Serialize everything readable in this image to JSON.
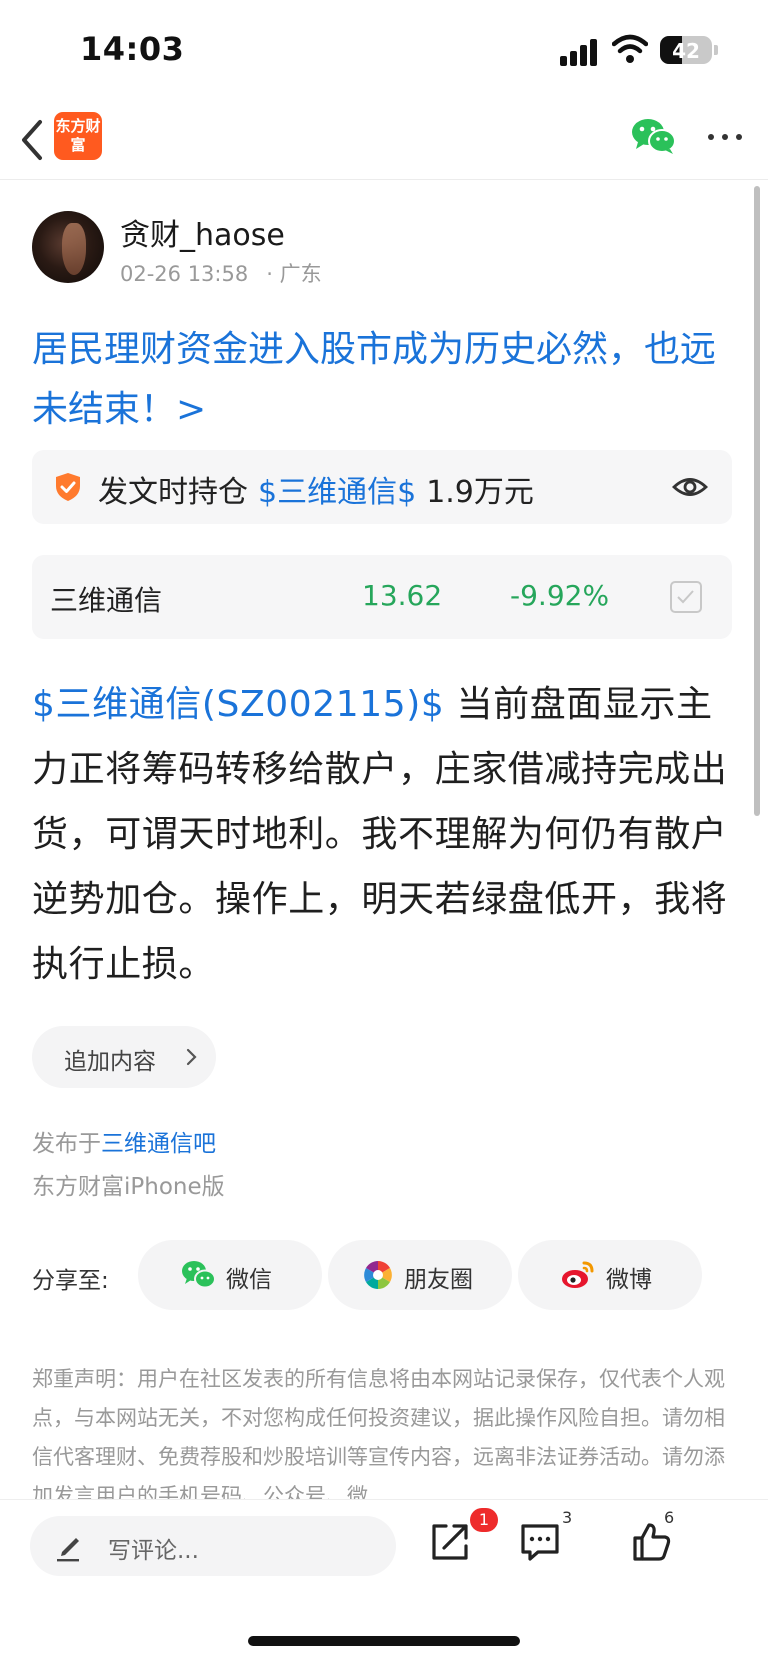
{
  "status_bar": {
    "time": "14:03",
    "battery": "42",
    "battery_level": 0.42
  },
  "nav": {
    "logo_text": "东方财富",
    "icons": [
      "back-icon",
      "wechat-icon",
      "more-icon"
    ]
  },
  "author": {
    "name": "贪财_haose",
    "datetime": "02-26 13:58",
    "location": "· 广东"
  },
  "post": {
    "title": "居民理财资金进入股市成为历史必然，也远未结束！>",
    "holding": {
      "label": "发文时持仓",
      "stock": "$三维通信$",
      "amount": "1.9万元"
    },
    "quote": {
      "name": "三维通信",
      "price": "13.62",
      "change": "-9.92%",
      "color": "#26a65b"
    },
    "body_tag": "$三维通信(SZ002115)$",
    "body_text": " 当前盘面显示主力正将筹码转移给散户，庄家借减持完成出货，可谓天时地利。我不理解为何仍有散户逆势加仓。操作上，明天若绿盘低开，我将执行止损。",
    "append_label": "追加内容",
    "published_prefix": "发布于",
    "published_bar": "三维通信吧",
    "client": "东方财富iPhone版"
  },
  "share": {
    "label": "分享至:",
    "buttons": [
      {
        "label": "微信",
        "icon": "wechat-icon"
      },
      {
        "label": "朋友圈",
        "icon": "moments-icon"
      },
      {
        "label": "微博",
        "icon": "weibo-icon"
      }
    ]
  },
  "disclaimer": "郑重声明：用户在社区发表的所有信息将由本网站记录保存，仅代表个人观点，与本网站无关，不对您构成任何投资建议，据此操作风险自担。请勿相信代客理财、免费荐股和炒股培训等宣传内容，远离非法证券活动。请勿添加发言用户的手机号码、公众号、微",
  "bottom_bar": {
    "comment_placeholder": "写评论...",
    "share_badge": "1",
    "comment_count": "3",
    "like_count": "6"
  },
  "colors": {
    "link_blue": "#1a73d9",
    "brand_orange": "#ff5a1f",
    "down_green": "#26a65b"
  }
}
